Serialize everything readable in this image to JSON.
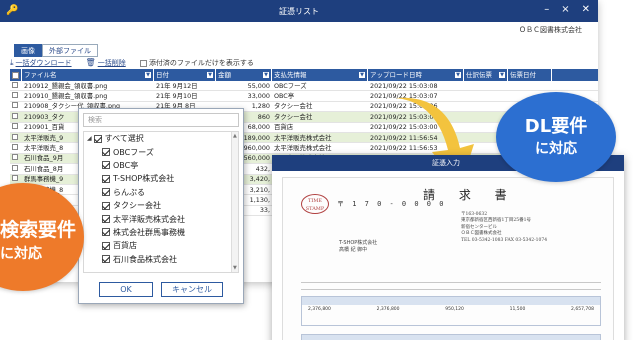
{
  "window": {
    "title": "証憑リスト",
    "company": "ＯＢＣ図書株式会社",
    "controls": [
      "–",
      "×",
      "✕"
    ]
  },
  "tabs": [
    {
      "label": "画像",
      "active": true
    },
    {
      "label": "外部ファイル",
      "active": false
    }
  ],
  "toolbar": {
    "download_label": "一括ダウンロード",
    "delete_label": "一括削除",
    "filter_label": "添付済のファイルだけを表示する"
  },
  "table": {
    "columns": [
      "ファイル名",
      "日付",
      "金額",
      "支払先情報",
      "アップロード日時",
      "仕訳伝票",
      "伝票日付"
    ],
    "rows": [
      {
        "file": "210912_懇親会_領収書.png",
        "date": "21年 9月12日",
        "amount": "55,000",
        "payee": "OBCフーズ",
        "uploaded": "2021/09/22 15:03:08",
        "selected": false
      },
      {
        "file": "210910_懇親会_領収書.png",
        "date": "21年 9月10日",
        "amount": "33,000",
        "payee": "OBC亭",
        "uploaded": "2021/09/22 15:03:07",
        "selected": false
      },
      {
        "file": "210908_タクシー代_領収書.png",
        "date": "21年 9月 8日",
        "amount": "1,280",
        "payee": "タクシー会社",
        "uploaded": "2021/09/22 15:03:06",
        "selected": false
      },
      {
        "file": "210903_タク",
        "date": "",
        "amount": "860",
        "payee": "タクシー会社",
        "uploaded": "2021/09/22 15:03:03",
        "selected": true
      },
      {
        "file": "210901_百貨",
        "date": "",
        "amount": "68,000",
        "payee": "百貨店",
        "uploaded": "2021/09/22 15:03:00",
        "selected": false
      },
      {
        "file": "太平洋販売_9",
        "date": "",
        "amount": "2,189,000",
        "payee": "太平洋販売株式会社",
        "uploaded": "2021/09/22 11:56:54",
        "selected": true
      },
      {
        "file": "太平洋販売_8",
        "date": "",
        "amount": "960,000",
        "payee": "太平洋販売株式会社",
        "uploaded": "2021/09/22 11:56:53",
        "selected": false
      },
      {
        "file": "石川食品_9月",
        "date": "",
        "amount": "560,000",
        "payee": "石川食品株式会社",
        "uploaded": "2021/09/22 11:56:52",
        "selected": true
      },
      {
        "file": "石川食品_8月",
        "date": "",
        "amount": "432,",
        "payee": "",
        "uploaded": "",
        "selected": false
      },
      {
        "file": "群馬事務機_9",
        "date": "",
        "amount": "3,420,",
        "payee": "",
        "uploaded": "",
        "selected": true
      },
      {
        "file": "群馬事務機_8",
        "date": "",
        "amount": "3,210,",
        "payee": "",
        "uploaded": "",
        "selected": false
      },
      {
        "file": "T-SHOP_9月",
        "date": "",
        "amount": "1,130,",
        "payee": "",
        "uploaded": "",
        "selected": false
      },
      {
        "file": "",
        "date": "",
        "amount": "33,",
        "payee": "",
        "uploaded": "",
        "selected": false
      }
    ]
  },
  "filter_panel": {
    "search_placeholder": "検索",
    "all_label": "すべて選択",
    "items": [
      {
        "label": "OBCフーズ",
        "checked": true
      },
      {
        "label": "OBC亭",
        "checked": true
      },
      {
        "label": "T-SHOP株式会社",
        "checked": true
      },
      {
        "label": "らんぷる",
        "checked": true
      },
      {
        "label": "タクシー会社",
        "checked": true
      },
      {
        "label": "太平洋販売株式会社",
        "checked": true
      },
      {
        "label": "株式会社群馬事務機",
        "checked": true
      },
      {
        "label": "百貨店",
        "checked": true
      },
      {
        "label": "石川食品株式会社",
        "checked": true
      }
    ],
    "ok_label": "OK",
    "cancel_label": "キャンセル"
  },
  "invoice": {
    "window_title": "証憑入力",
    "heading": "請 求 書",
    "stamp": "TIME STAMP",
    "postal": "〒 1 7 0 - 0 0 0 0",
    "customer": [
      "T-SHOP株式会社",
      "高橋 紀 御中"
    ],
    "issuer": [
      "〒163-0632",
      "東京都新宿区西新宿1丁目25番1号",
      "新宿センタービル",
      "ＯＢＣ図書株式会社",
      "TEL 03-5342-1083  FAX 03-5342-1074"
    ],
    "amounts": [
      "2,376,800",
      "2,376,800",
      "950,120",
      "11,500",
      "2,657,708"
    ]
  },
  "callouts": {
    "dl": {
      "line1": "DL要件",
      "line2": "に対応",
      "color": "#2c6fd1"
    },
    "search": {
      "line1": "検索要件",
      "line2": "に対応",
      "color": "#ee7a2a"
    }
  },
  "colors": {
    "header": "#1e3f7e",
    "grid_header": "#2d5aa0",
    "arrow": "#f3c33e"
  }
}
